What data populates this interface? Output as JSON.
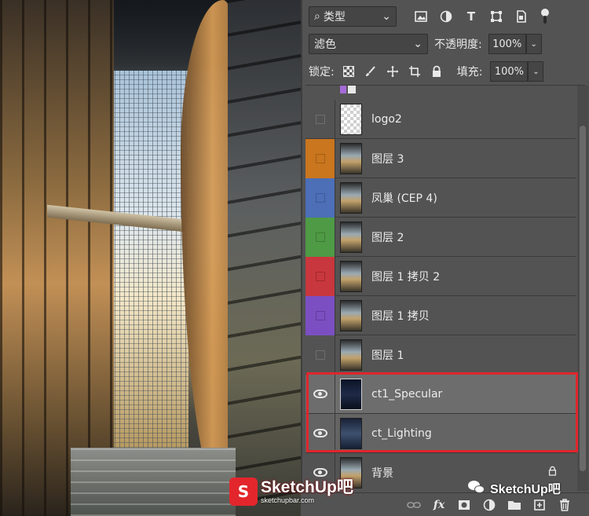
{
  "filter_bar": {
    "kind_label": "类型",
    "icons": [
      "image-filter-icon",
      "adjustment-filter-icon",
      "type-filter-icon",
      "shape-filter-icon",
      "smart-object-filter-icon"
    ]
  },
  "blend": {
    "mode": "滤色",
    "opacity_label": "不透明度:",
    "opacity_value": "100%"
  },
  "lock": {
    "label": "锁定:",
    "fill_label": "填充:",
    "fill_value": "100%"
  },
  "layers": [
    {
      "name": "logo2",
      "visible": false,
      "color": "#535353",
      "thumb": "checker"
    },
    {
      "name": "图层 3",
      "visible": false,
      "color": "#c9761e",
      "thumb": "render"
    },
    {
      "name": "凤巢 (CEP 4)",
      "visible": false,
      "color": "#4c6fb7",
      "thumb": "render"
    },
    {
      "name": "图层 2",
      "visible": false,
      "color": "#4f9a45",
      "thumb": "render"
    },
    {
      "name": "图层 1 拷贝 2",
      "visible": false,
      "color": "#c8373d",
      "thumb": "render"
    },
    {
      "name": "图层 1 拷贝",
      "visible": false,
      "color": "#7b4fc1",
      "thumb": "render"
    },
    {
      "name": "图层 1",
      "visible": false,
      "color": "#535353",
      "thumb": "render"
    },
    {
      "name": "ct1_Specular",
      "visible": true,
      "color": "#6d6d6d",
      "thumb": "dark"
    },
    {
      "name": "ct_Lighting",
      "visible": true,
      "color": "#646464",
      "thumb": "light"
    },
    {
      "name": "背景",
      "visible": true,
      "color": "#535353",
      "thumb": "render",
      "locked": true
    }
  ],
  "watermarks": {
    "left_brand": "SketchUp吧",
    "left_url": "sketchupbar.com",
    "right_text": "SketchUp吧"
  },
  "colors": {
    "panel_bg": "#535353",
    "highlight": "#e0262c"
  }
}
